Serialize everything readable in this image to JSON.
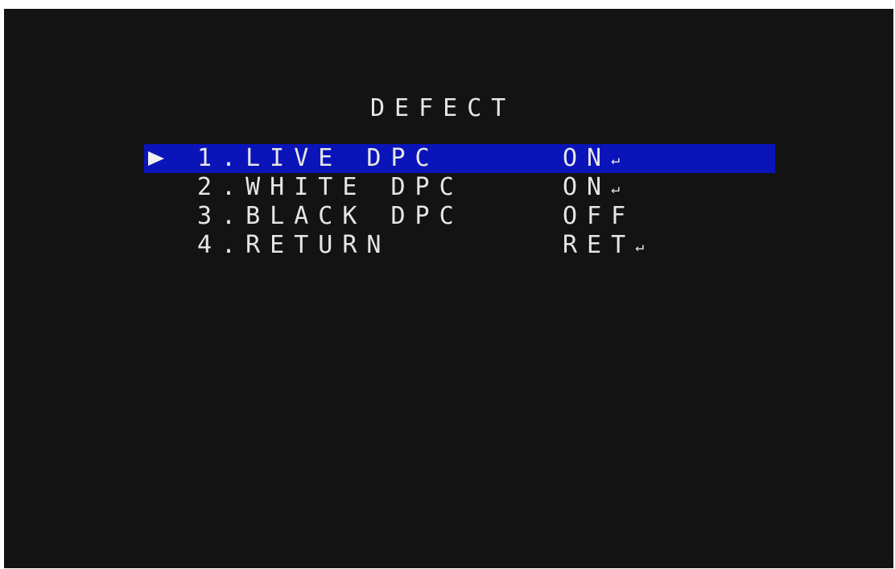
{
  "menu": {
    "title": "DEFECT",
    "items": [
      {
        "label": "1.LIVE DPC",
        "value": "ON",
        "enter_icon": "↵",
        "icon_name": "enter-icon"
      },
      {
        "label": "2.WHITE DPC",
        "value": "ON",
        "enter_icon": "↵",
        "icon_name": "enter-icon"
      },
      {
        "label": "3.BLACK DPC",
        "value": "OFF"
      },
      {
        "label": "4.RETURN",
        "value": "RET",
        "enter_icon": "↵",
        "icon_name": "enter-icon"
      }
    ],
    "selected_index": 0,
    "cursor_icon": "triangle-right-icon",
    "colors": {
      "background": "#131313",
      "text": "#e6e6e6",
      "highlight": "#0a14b9"
    }
  }
}
